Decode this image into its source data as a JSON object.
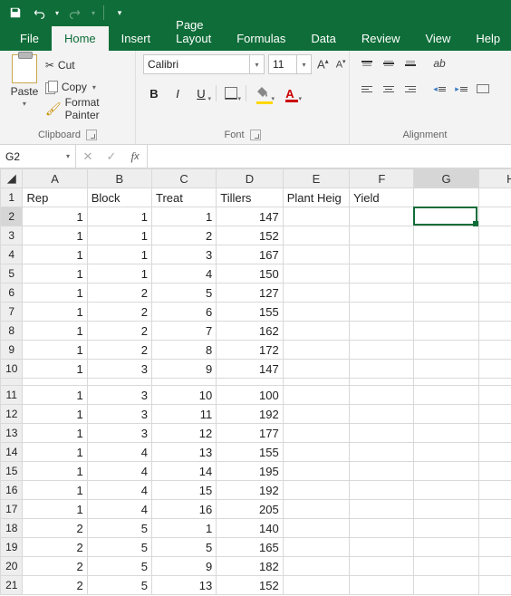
{
  "qat": {
    "save": "save-icon",
    "undo": "undo-icon",
    "redo": "redo-icon"
  },
  "tabs": {
    "file": "File",
    "home": "Home",
    "insert": "Insert",
    "pagelayout": "Page Layout",
    "formulas": "Formulas",
    "data": "Data",
    "review": "Review",
    "view": "View",
    "help": "Help"
  },
  "ribbon": {
    "clipboard": {
      "paste": "Paste",
      "cut": "Cut",
      "copy": "Copy",
      "formatpainter": "Format Painter",
      "group": "Clipboard"
    },
    "font": {
      "name": "Calibri",
      "size": "11",
      "group": "Font"
    },
    "alignment": {
      "group": "Alignment"
    }
  },
  "namebox": "G2",
  "formula": "",
  "columns": [
    "A",
    "B",
    "C",
    "D",
    "E",
    "F",
    "G",
    "H"
  ],
  "headers": {
    "A": "Rep",
    "B": "Block",
    "C": "Treat",
    "D": "Tillers",
    "E": "Plant Heig",
    "F": "Yield"
  },
  "rows": [
    {
      "n": 2,
      "A": 1,
      "B": 1,
      "C": 1,
      "D": 147
    },
    {
      "n": 3,
      "A": 1,
      "B": 1,
      "C": 2,
      "D": 152
    },
    {
      "n": 4,
      "A": 1,
      "B": 1,
      "C": 3,
      "D": 167
    },
    {
      "n": 5,
      "A": 1,
      "B": 1,
      "C": 4,
      "D": 150
    },
    {
      "n": 6,
      "A": 1,
      "B": 2,
      "C": 5,
      "D": 127
    },
    {
      "n": 7,
      "A": 1,
      "B": 2,
      "C": 6,
      "D": 155
    },
    {
      "n": 8,
      "A": 1,
      "B": 2,
      "C": 7,
      "D": 162
    },
    {
      "n": 9,
      "A": 1,
      "B": 2,
      "C": 8,
      "D": 172
    },
    {
      "n": 10,
      "A": 1,
      "B": 3,
      "C": 9,
      "D": 147
    },
    {
      "n": 11,
      "A": 1,
      "B": 3,
      "C": 10,
      "D": 100
    },
    {
      "n": 12,
      "A": 1,
      "B": 3,
      "C": 11,
      "D": 192
    },
    {
      "n": 13,
      "A": 1,
      "B": 3,
      "C": 12,
      "D": 177
    },
    {
      "n": 14,
      "A": 1,
      "B": 4,
      "C": 13,
      "D": 155
    },
    {
      "n": 15,
      "A": 1,
      "B": 4,
      "C": 14,
      "D": 195
    },
    {
      "n": 16,
      "A": 1,
      "B": 4,
      "C": 15,
      "D": 192
    },
    {
      "n": 17,
      "A": 1,
      "B": 4,
      "C": 16,
      "D": 205
    },
    {
      "n": 18,
      "A": 2,
      "B": 5,
      "C": 1,
      "D": 140
    },
    {
      "n": 19,
      "A": 2,
      "B": 5,
      "C": 5,
      "D": 165
    },
    {
      "n": 20,
      "A": 2,
      "B": 5,
      "C": 9,
      "D": 182
    },
    {
      "n": 21,
      "A": 2,
      "B": 5,
      "C": 13,
      "D": 152
    }
  ],
  "selected": {
    "col": "G",
    "row": 2
  }
}
